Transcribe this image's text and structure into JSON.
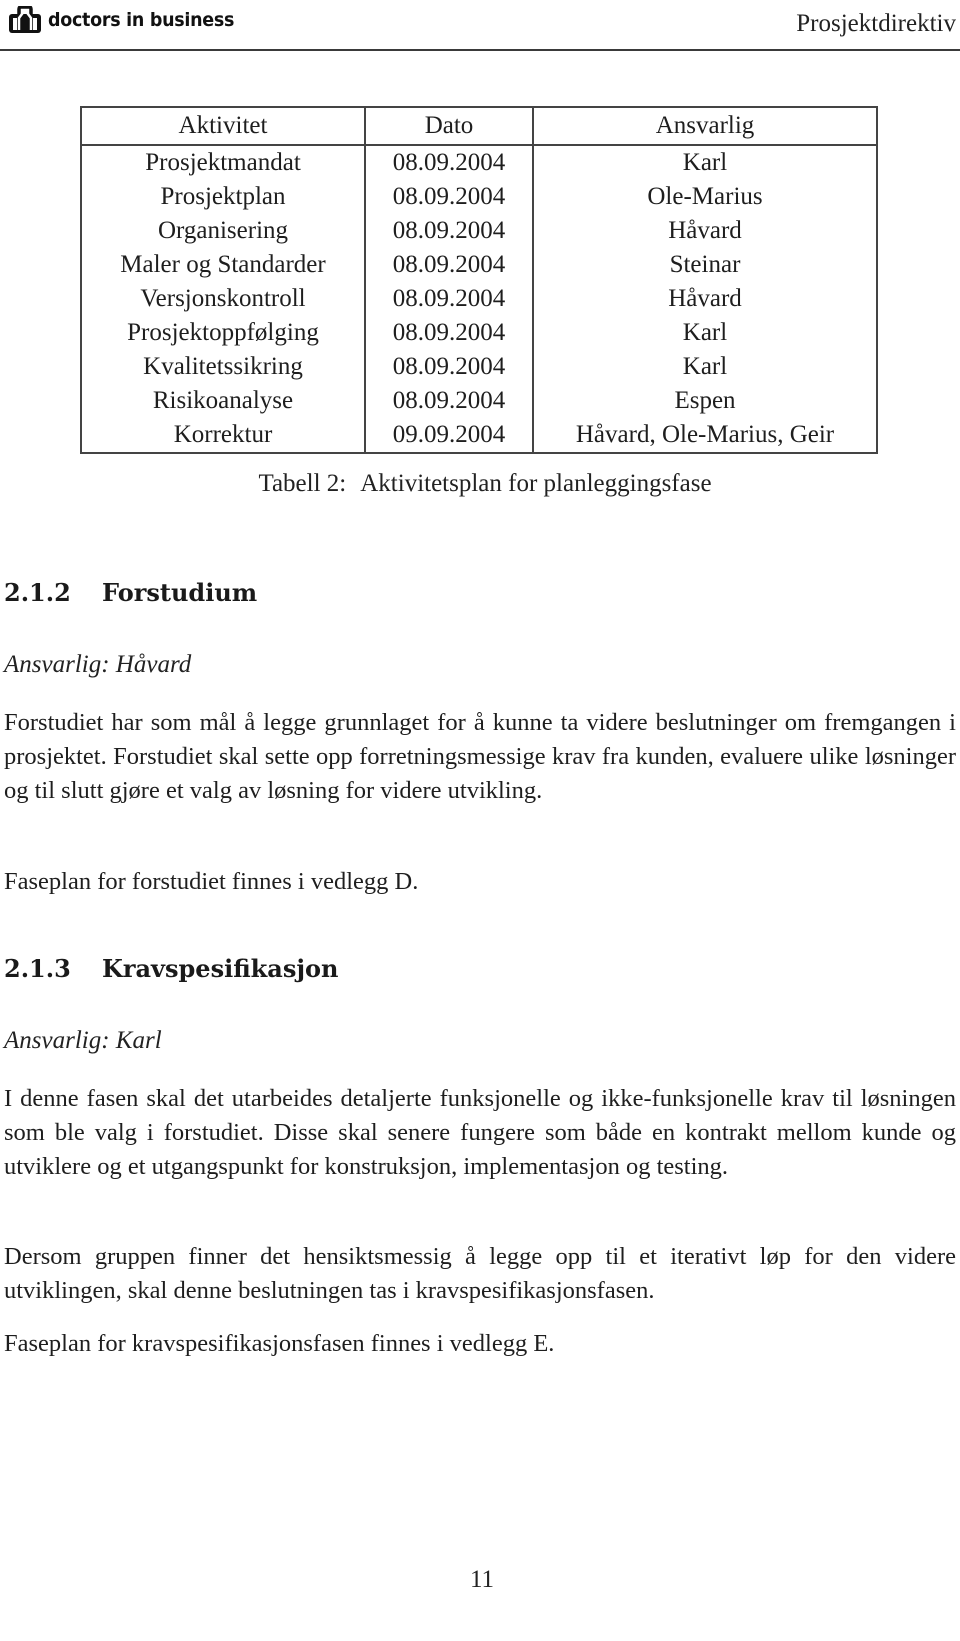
{
  "header": {
    "logo_text": "doctors in business",
    "logo_icon": "doctors-bag-logo-icon",
    "title": "Prosjektdirektiv"
  },
  "table": {
    "columns": [
      "Aktivitet",
      "Dato",
      "Ansvarlig"
    ],
    "rows": [
      [
        "Prosjektmandat",
        "08.09.2004",
        "Karl"
      ],
      [
        "Prosjektplan",
        "08.09.2004",
        "Ole-Marius"
      ],
      [
        "Organisering",
        "08.09.2004",
        "Håvard"
      ],
      [
        "Maler og Standarder",
        "08.09.2004",
        "Steinar"
      ],
      [
        "Versjonskontroll",
        "08.09.2004",
        "Håvard"
      ],
      [
        "Prosjektoppfølging",
        "08.09.2004",
        "Karl"
      ],
      [
        "Kvalitetssikring",
        "08.09.2004",
        "Karl"
      ],
      [
        "Risikoanalyse",
        "08.09.2004",
        "Espen"
      ],
      [
        "Korrektur",
        "09.09.2004",
        "Håvard, Ole-Marius, Geir"
      ]
    ],
    "caption_label": "Tabell 2:",
    "caption_text": "Aktivitetsplan for planleggingsfase"
  },
  "sections": [
    {
      "number": "2.1.2",
      "title": "Forstudium",
      "responsible": "Ansvarlig: Håvard",
      "paragraphs": [
        "Forstudiet har som mål å legge grunnlaget for å kunne ta videre beslutninger om fremgangen i prosjektet. Forstudiet skal sette opp forretningsmessige krav fra kunden, evaluere ulike løsninger og til slutt gjøre et valg av løsning for videre utvikling.",
        "Faseplan for forstudiet finnes i vedlegg D."
      ]
    },
    {
      "number": "2.1.3",
      "title": "Kravspesifikasjon",
      "responsible": "Ansvarlig: Karl",
      "paragraphs": [
        "I denne fasen skal det utarbeides detaljerte funksjonelle og ikke-funksjonelle krav til løsningen som ble valg i forstudiet. Disse skal senere fungere som både en kontrakt mellom kunde og utviklere og et utgangspunkt for konstruksjon, implementasjon og testing.",
        "Dersom gruppen finner det hensiktsmessig å legge opp til et iterativt løp for den videre utviklingen, skal denne beslutningen tas i kravspesifikasjonsfasen.",
        "Faseplan for kravspesifikasjonsfasen finnes i vedlegg E."
      ]
    }
  ],
  "footer": {
    "page_number": "11"
  }
}
